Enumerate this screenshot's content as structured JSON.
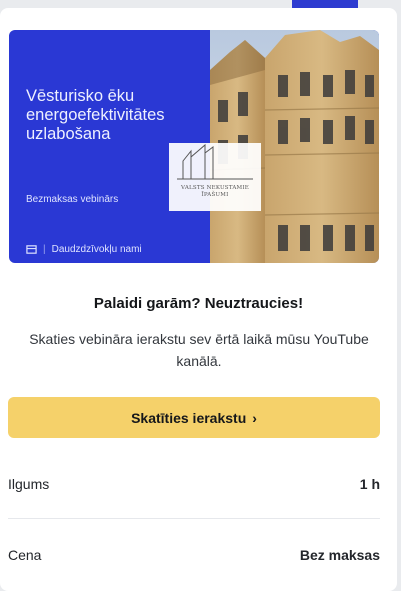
{
  "banner": {
    "title": "Vēsturisko ēku energoefektivitātes uzlabošana",
    "subtitle": "Bezmaksas vebinārs",
    "location": "Daudzdzīvokļu nami",
    "logo_text_line1": "VALSTS NEKUSTAMIE",
    "logo_text_line2": "ĪPAŠUMI",
    "colors": {
      "background": "#2a38d4"
    }
  },
  "content": {
    "headline": "Palaidi garām? Neuztraucies!",
    "description": "Skaties vebināra ierakstu sev ērtā laikā mūsu YouTube kanālā."
  },
  "cta": {
    "label": "Skatīties ierakstu",
    "icon": "chevron-right-icon",
    "color": "#f5d16a"
  },
  "details": [
    {
      "label": "Ilgums",
      "value": "1 h"
    },
    {
      "label": "Cena",
      "value": "Bez maksas"
    }
  ]
}
